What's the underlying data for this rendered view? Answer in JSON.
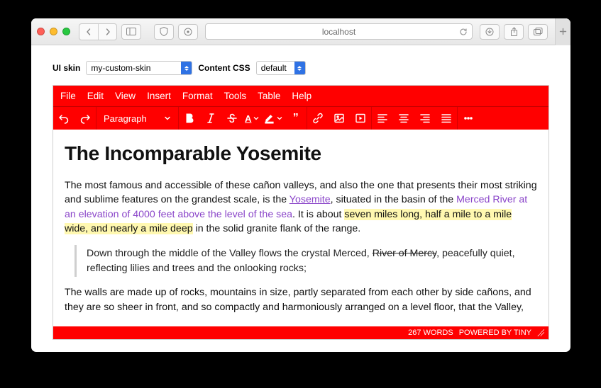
{
  "browser": {
    "url_display": "localhost"
  },
  "config": {
    "skin_label": "UI skin",
    "skin_value": "my-custom-skin",
    "css_label": "Content CSS",
    "css_value": "default"
  },
  "editor": {
    "menus": [
      "File",
      "Edit",
      "View",
      "Insert",
      "Format",
      "Tools",
      "Table",
      "Help"
    ],
    "block_format": "Paragraph",
    "status": {
      "words": "267 WORDS",
      "powered": "POWERED BY TINY"
    }
  },
  "doc": {
    "title": "The Incomparable Yosemite",
    "p1_a": "The most famous and accessible of these cañon valleys, and also the one that presents their most striking and sublime features on the grandest scale, is the ",
    "p1_link1": "Yosemite",
    "p1_b": ", situated in the basin of the ",
    "p1_link2": "Merced River at an elevation of 4000 feet above the level of the sea",
    "p1_c": ". It is about ",
    "p1_hl": "seven miles long, half a mile to a mile wide, and nearly a mile deep",
    "p1_d": " in the solid granite flank of the range.",
    "bq_a": "Down through the middle of the Valley flows the crystal Merced, ",
    "bq_strike": "River of Mercy",
    "bq_b": ", peacefully quiet, reflecting lilies and trees and the onlooking rocks;",
    "p2": "The walls are made up of rocks, mountains in size, partly separated from each other by side cañons, and they are so sheer in front, and so compactly and harmoniously arranged on a level floor, that the Valley,"
  }
}
